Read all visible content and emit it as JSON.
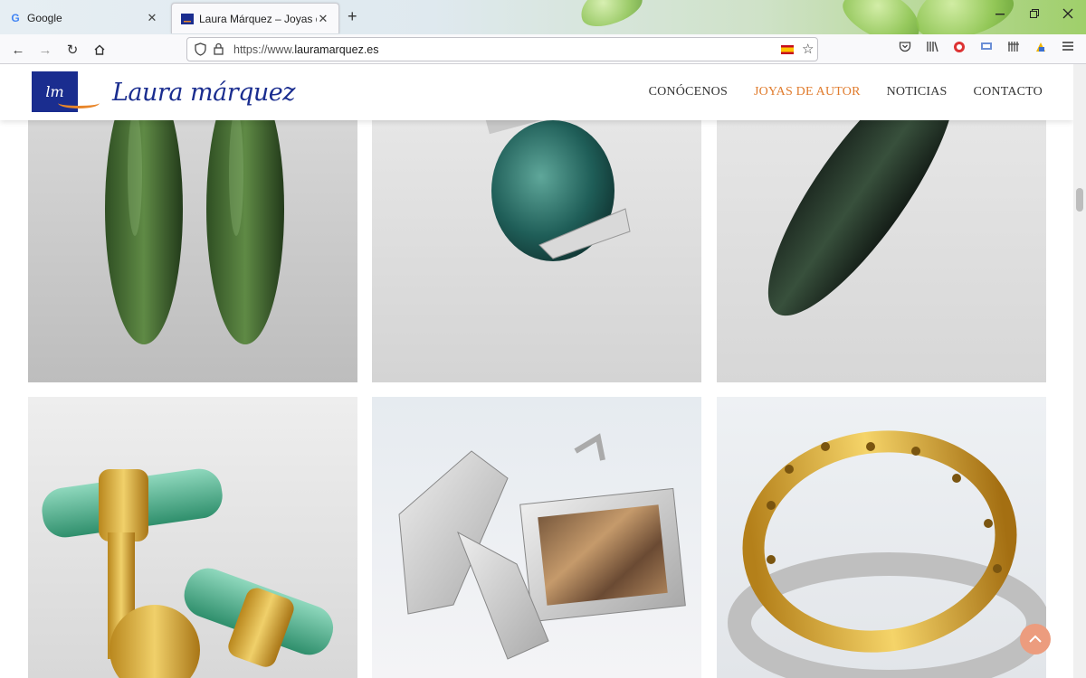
{
  "browser": {
    "tabs": [
      {
        "title": "Google",
        "favicon": "google-g-icon",
        "active": false
      },
      {
        "title": "Laura Márquez – Joyas de Autor",
        "favicon": "lm-site-icon",
        "active": true
      }
    ],
    "url_prefix": "https://www.",
    "url_domain": "lauramarquez.es",
    "colors": {
      "accent": "#e07b2c",
      "brand": "#1a2d8f"
    }
  },
  "site": {
    "logo_box_text": "lm",
    "logo_text": "Laura márquez",
    "nav": [
      {
        "label": "CONÓCENOS",
        "active": false
      },
      {
        "label": "JOYAS DE AUTOR",
        "active": true
      },
      {
        "label": "NOTICIAS",
        "active": false
      },
      {
        "label": "CONTACTO",
        "active": false
      }
    ]
  },
  "gallery": [
    {
      "subject": "green jade earrings"
    },
    {
      "subject": "teal gemstone pendant"
    },
    {
      "subject": "dark green stone pendant"
    },
    {
      "subject": "gold and emerald cufflinks"
    },
    {
      "subject": "silver and agate cufflinks"
    },
    {
      "subject": "gold and silver rings"
    }
  ]
}
